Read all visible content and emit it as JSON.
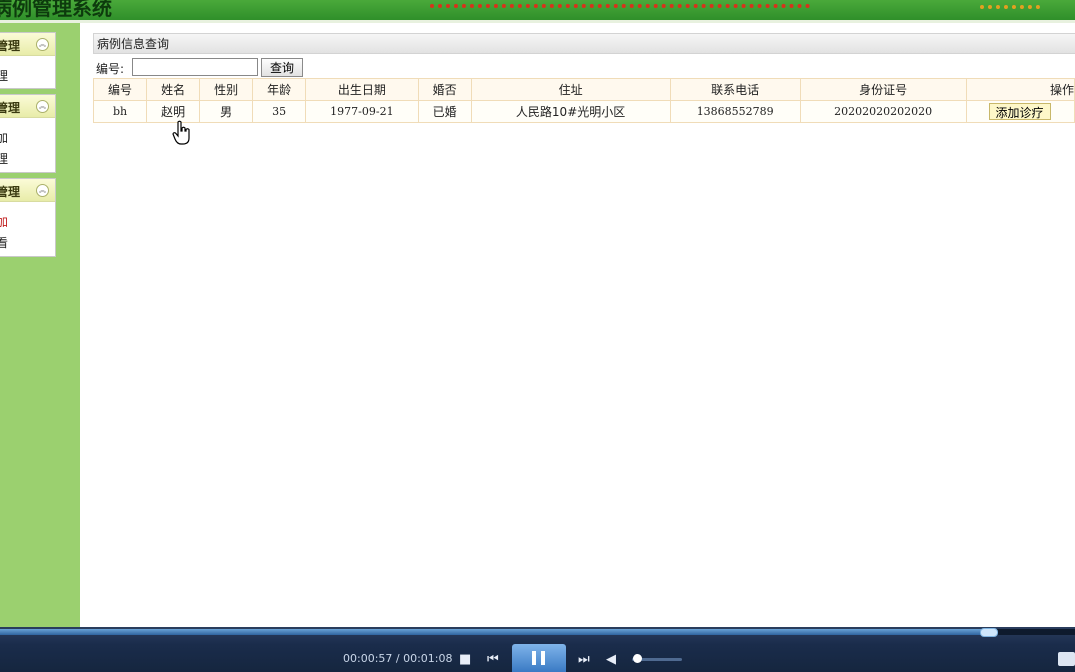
{
  "header": {
    "title": "病例管理系统"
  },
  "sidebar": {
    "groups": [
      {
        "label": "管理",
        "items": [
          "理"
        ]
      },
      {
        "label": "管理",
        "items": [
          "加",
          "理"
        ]
      },
      {
        "label": "管理",
        "items": [
          "加",
          "看"
        ]
      }
    ],
    "toggle_glyph": "︽"
  },
  "main": {
    "panel_title": "病例信息查询",
    "search": {
      "label": "编号:",
      "value": "",
      "button": "查询"
    },
    "table": {
      "columns": [
        "编号",
        "姓名",
        "性别",
        "年龄",
        "出生日期",
        "婚否",
        "住址",
        "联系电话",
        "身份证号",
        "操作"
      ],
      "rows": [
        {
          "id": "bh",
          "name": "赵明",
          "gender": "男",
          "age": "35",
          "birth": "1977-09-21",
          "married": "已婚",
          "address": "人民路10#光明小区",
          "phone": "13868552789",
          "id_card": "20202020202020",
          "action": "添加诊疗"
        }
      ]
    }
  },
  "player": {
    "time": "00:00:57 / 00:01:08",
    "progress": 0.919,
    "volume": 0.1,
    "accent": "#3a7ac4"
  }
}
